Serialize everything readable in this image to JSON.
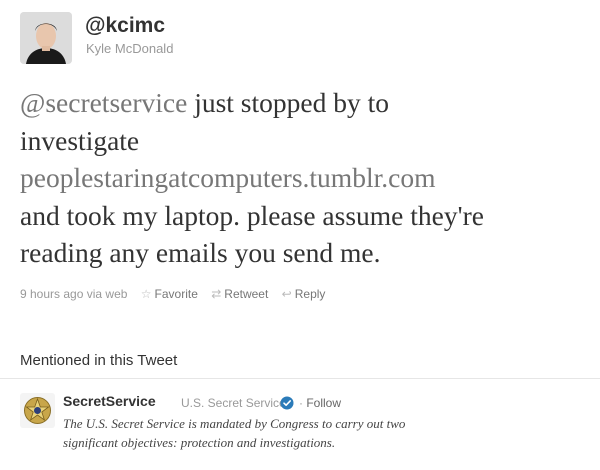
{
  "tweet": {
    "handle": "@kcimc",
    "full_name": "Kyle McDonald",
    "text_lines": [
      {
        "mention": "@secretservice",
        "rest": " just stopped by to"
      },
      {
        "plain": "investigate"
      },
      {
        "link": "peoplestaringatcomputers.tumblr.com"
      },
      {
        "plain": "and took my laptop. please assume they're"
      },
      {
        "plain": "reading any emails you send me."
      }
    ],
    "timestamp": "9 hours ago",
    "via": "via web",
    "actions": {
      "favorite": "Favorite",
      "retweet": "Retweet",
      "reply": "Reply"
    }
  },
  "mentioned": {
    "title": "Mentioned in this Tweet",
    "account": {
      "name": "SecretService",
      "full_name": "U.S. Secret Service",
      "follow_sep": "·",
      "follow": "Follow",
      "bio_lines": [
        "The U.S. Secret Service is mandated by Congress to carry out two",
        "significant objectives: protection and investigations."
      ]
    }
  },
  "colors": {
    "text": "#333333",
    "muted": "#999999",
    "link": "#777777",
    "verified": "#2b7bb9"
  },
  "icons": {
    "favorite": "star-icon",
    "retweet": "retweet-icon",
    "reply": "reply-icon",
    "verified": "verified-badge-icon"
  }
}
